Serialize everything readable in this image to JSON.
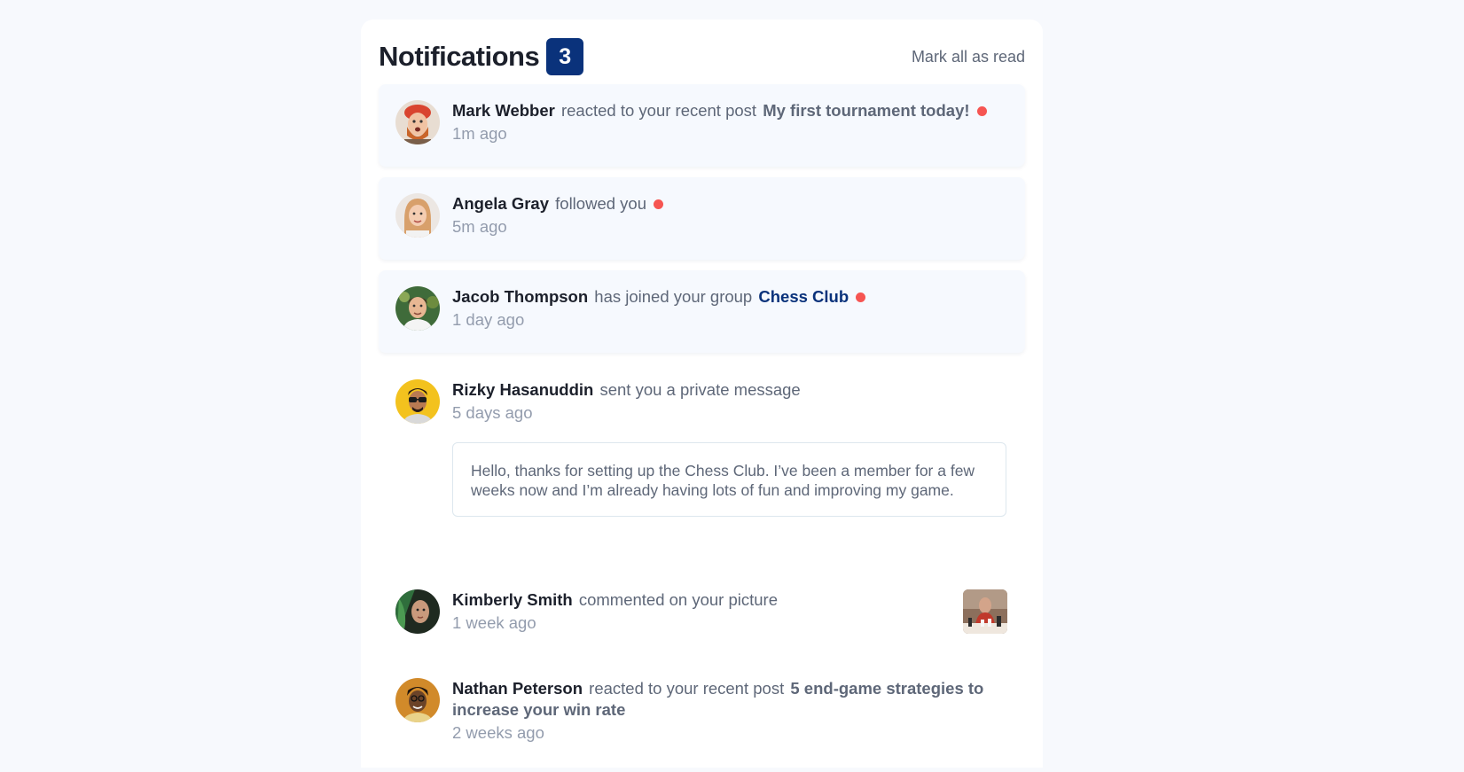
{
  "header": {
    "title": "Notifications",
    "unread_count": "3",
    "mark_all_label": "Mark all as read"
  },
  "colors": {
    "unread_dot": "#f65552",
    "badge_bg": "#0a327b",
    "unread_bg": "#f6f9fe"
  },
  "notifications": [
    {
      "user": "Mark Webber",
      "action": "reacted to your recent post",
      "target": "My first tournament today!",
      "time": "1m ago",
      "unread": true,
      "avatar_icon": "avatar-mark-webber"
    },
    {
      "user": "Angela Gray",
      "action": "followed you",
      "time": "5m ago",
      "unread": true,
      "avatar_icon": "avatar-angela-gray"
    },
    {
      "user": "Jacob Thompson",
      "action": "has joined your group",
      "target": "Chess Club",
      "time": "1 day ago",
      "unread": true,
      "avatar_icon": "avatar-jacob-thompson"
    },
    {
      "user": "Rizky Hasanuddin",
      "action": "sent you a private message",
      "time": "5 days ago",
      "unread": false,
      "message": "Hello, thanks for setting up the Chess Club. I’ve been a member for a few weeks now and I’m already having lots of fun and improving my game.",
      "avatar_icon": "avatar-rizky-hasanuddin"
    },
    {
      "user": "Kimberly Smith",
      "action": "commented on your picture",
      "time": "1 week ago",
      "unread": false,
      "picture_icon": "chess-picture",
      "avatar_icon": "avatar-kimberly-smith"
    },
    {
      "user": "Nathan Peterson",
      "action": "reacted to your recent post",
      "target": "5 end-game strategies to increase your win rate",
      "time": "2 weeks ago",
      "unread": false,
      "avatar_icon": "avatar-nathan-peterson"
    }
  ]
}
